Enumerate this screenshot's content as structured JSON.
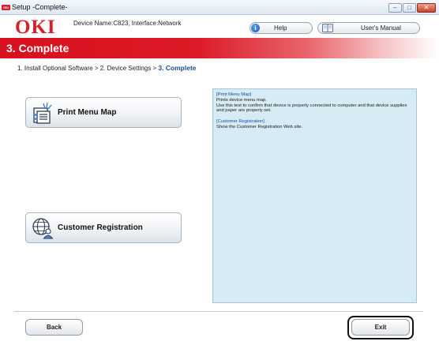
{
  "window": {
    "title": "Setup -Complete-",
    "app_badge": "OKI",
    "controls": {
      "minimize": "–",
      "maximize": "□",
      "close": "✕"
    }
  },
  "header": {
    "logo": "OKI",
    "device_info": "Device Name:C823, Interface:Network",
    "help_label": "Help",
    "manual_label": "User's Manual"
  },
  "banner": {
    "title": "3. Complete"
  },
  "breadcrumb": {
    "step1": "1. Install Optional Software",
    "sep1": " > ",
    "step2": "2. Device Settings",
    "sep2": " > ",
    "step3": "3. Complete"
  },
  "actions": {
    "print_menu_map": "Print Menu Map",
    "customer_registration": "Customer Registration"
  },
  "description": {
    "print_head": "[Print Menu Map]",
    "print_line1": "Prints device menu map.",
    "print_line2": "Use this test to confirm that device is properly connected to computer and that device supplies and paper are properly set.",
    "reg_head": "[Customer Registration]",
    "reg_line1": "Show the Customer Registration Web site."
  },
  "footer": {
    "back_label": "Back",
    "exit_label": "Exit"
  },
  "colors": {
    "brand_red": "#d81e27",
    "panel_bg": "#d6ebf3",
    "link_blue": "#1f46b4",
    "highlight": "#111111"
  },
  "icons": {
    "app": "oki-app-icon",
    "help": "info-icon",
    "manual": "book-icon",
    "print": "printer-sheet-icon",
    "registration": "globe-user-icon"
  }
}
